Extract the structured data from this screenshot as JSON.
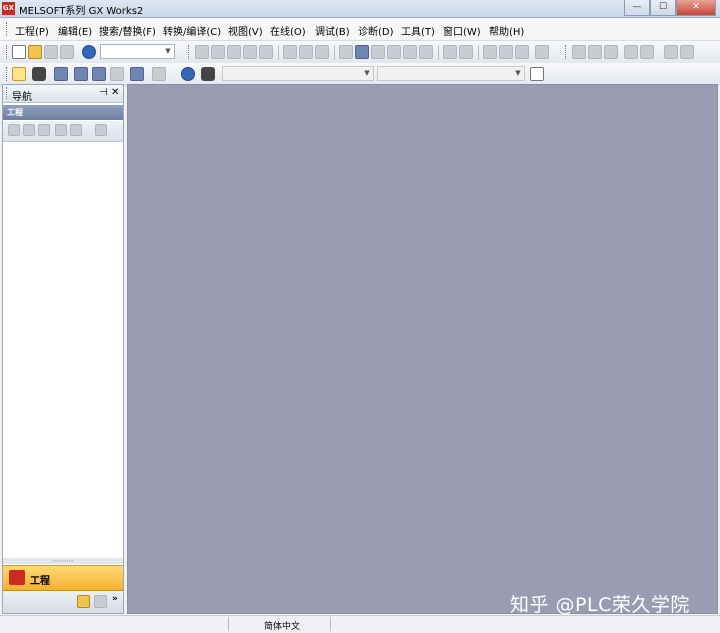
{
  "window": {
    "app_icon_text": "GX",
    "title": "MELSOFT系列 GX Works2",
    "minimize_glyph": "—",
    "maximize_glyph": "☐",
    "close_glyph": "✕"
  },
  "menu": [
    "工程(P)",
    "编辑(E)",
    "搜索/替换(F)",
    "转换/编译(C)",
    "视图(V)",
    "在线(O)",
    "调试(B)",
    "诊断(D)",
    "工具(T)",
    "窗口(W)",
    "帮助(H)"
  ],
  "navigation": {
    "title": "导航",
    "pin_glyph": "⊣",
    "close_glyph": "✕",
    "section_label": "工程",
    "splitter_glyph": "⋯⋯⋯",
    "project_button_label": "工程",
    "more_glyph": "»"
  },
  "statusbar": {
    "language": "简体中文"
  },
  "watermark": "知乎 @PLC荣久学院",
  "colors": {
    "workspace": "#9a9db2",
    "navigation_active": "#f4b12c"
  }
}
